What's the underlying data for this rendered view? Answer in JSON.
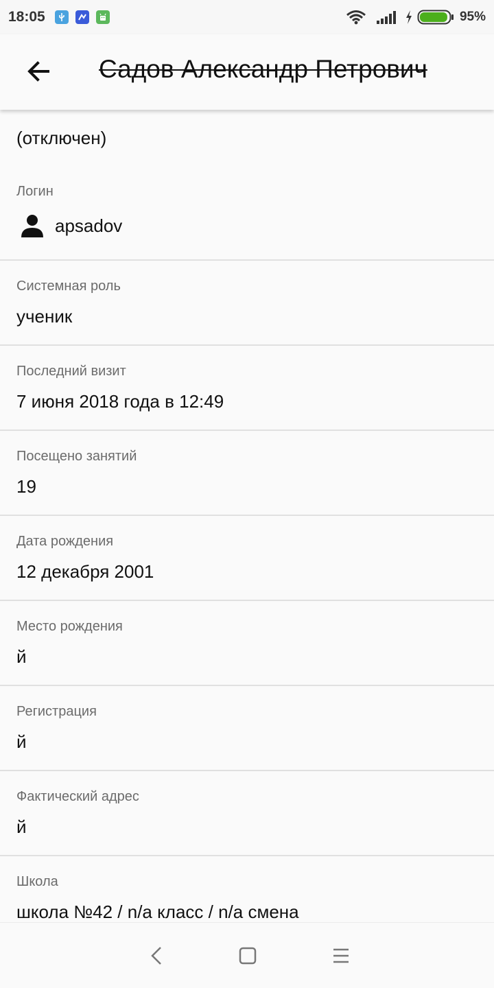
{
  "status_bar": {
    "time": "18:05",
    "battery_percent": "95%",
    "notification_icons": [
      "usb-icon",
      "app-notification-icon",
      "android-icon"
    ],
    "icons": [
      "wifi-icon",
      "signal-icon",
      "charging-icon",
      "battery-icon"
    ],
    "battery_color": "#4caf1c"
  },
  "app_bar": {
    "title": "Садов Александр Петрович"
  },
  "status_note": "(отключен)",
  "fields": {
    "login": {
      "label": "Логин",
      "value": "apsadov"
    },
    "role": {
      "label": "Системная роль",
      "value": "ученик"
    },
    "last_visit": {
      "label": "Последний визит",
      "value": "7 июня 2018 года в 12:49"
    },
    "attended": {
      "label": "Посещено занятий",
      "value": "19"
    },
    "birth_date": {
      "label": "Дата рождения",
      "value": "12 декабря 2001"
    },
    "birth_place": {
      "label": "Место рождения",
      "value": "й"
    },
    "registration": {
      "label": "Регистрация",
      "value": "й"
    },
    "actual_address": {
      "label": "Фактический адрес",
      "value": "й"
    },
    "school": {
      "label": "Школа",
      "value": "школа №42 / n/a класс / n/a смена"
    }
  },
  "nav_bar": {
    "buttons": [
      "back-nav-icon",
      "home-nav-icon",
      "menu-nav-icon"
    ]
  }
}
